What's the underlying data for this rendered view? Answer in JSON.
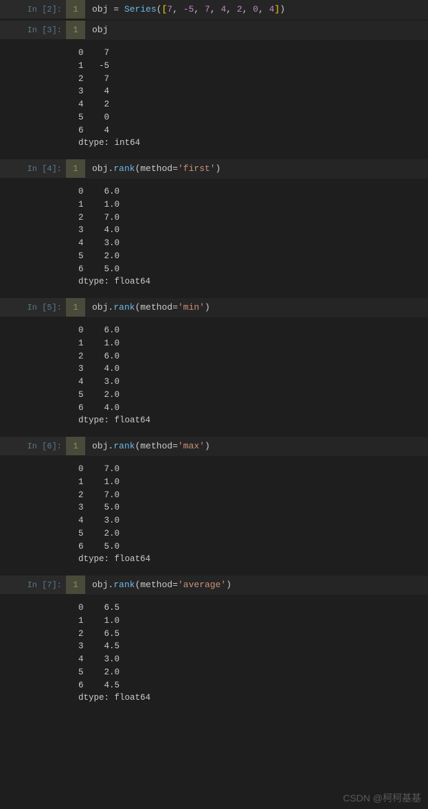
{
  "cells": [
    {
      "prompt": "In [2]:",
      "lineNo": "1",
      "code": [
        {
          "t": "obj ",
          "c": "tok-id"
        },
        {
          "t": "= ",
          "c": "tok-op"
        },
        {
          "t": "Series",
          "c": "tok-func"
        },
        {
          "t": "(",
          "c": "tok-punct"
        },
        {
          "t": "[",
          "c": "tok-bracket"
        },
        {
          "t": "7",
          "c": "tok-num"
        },
        {
          "t": ", ",
          "c": "tok-punct"
        },
        {
          "t": "-5",
          "c": "tok-num"
        },
        {
          "t": ", ",
          "c": "tok-punct"
        },
        {
          "t": "7",
          "c": "tok-num"
        },
        {
          "t": ", ",
          "c": "tok-punct"
        },
        {
          "t": "4",
          "c": "tok-num"
        },
        {
          "t": ", ",
          "c": "tok-punct"
        },
        {
          "t": "2",
          "c": "tok-num"
        },
        {
          "t": ", ",
          "c": "tok-punct"
        },
        {
          "t": "0",
          "c": "tok-num"
        },
        {
          "t": ", ",
          "c": "tok-punct"
        },
        {
          "t": "4",
          "c": "tok-num"
        },
        {
          "t": "]",
          "c": "tok-bracket"
        },
        {
          "t": ")",
          "c": "tok-punct"
        }
      ],
      "output": null
    },
    {
      "prompt": "In [3]:",
      "lineNo": "1",
      "code": [
        {
          "t": "obj",
          "c": "tok-id"
        }
      ],
      "output": "0    7\n1   -5\n2    7\n3    4\n4    2\n5    0\n6    4\ndtype: int64"
    },
    {
      "prompt": "In [4]:",
      "lineNo": "1",
      "code": [
        {
          "t": "obj",
          "c": "tok-id"
        },
        {
          "t": ".",
          "c": "tok-punct"
        },
        {
          "t": "rank",
          "c": "tok-func"
        },
        {
          "t": "(",
          "c": "tok-punct"
        },
        {
          "t": "method",
          "c": "tok-id"
        },
        {
          "t": "=",
          "c": "tok-op"
        },
        {
          "t": "'first'",
          "c": "tok-str"
        },
        {
          "t": ")",
          "c": "tok-punct"
        }
      ],
      "output": "0    6.0\n1    1.0\n2    7.0\n3    4.0\n4    3.0\n5    2.0\n6    5.0\ndtype: float64"
    },
    {
      "prompt": "In [5]:",
      "lineNo": "1",
      "code": [
        {
          "t": "obj",
          "c": "tok-id"
        },
        {
          "t": ".",
          "c": "tok-punct"
        },
        {
          "t": "rank",
          "c": "tok-func"
        },
        {
          "t": "(",
          "c": "tok-punct"
        },
        {
          "t": "method",
          "c": "tok-id"
        },
        {
          "t": "=",
          "c": "tok-op"
        },
        {
          "t": "'min'",
          "c": "tok-str"
        },
        {
          "t": ")",
          "c": "tok-punct"
        }
      ],
      "output": "0    6.0\n1    1.0\n2    6.0\n3    4.0\n4    3.0\n5    2.0\n6    4.0\ndtype: float64"
    },
    {
      "prompt": "In [6]:",
      "lineNo": "1",
      "code": [
        {
          "t": "obj",
          "c": "tok-id"
        },
        {
          "t": ".",
          "c": "tok-punct"
        },
        {
          "t": "rank",
          "c": "tok-func"
        },
        {
          "t": "(",
          "c": "tok-punct"
        },
        {
          "t": "method",
          "c": "tok-id"
        },
        {
          "t": "=",
          "c": "tok-op"
        },
        {
          "t": "'max'",
          "c": "tok-str"
        },
        {
          "t": ")",
          "c": "tok-punct"
        }
      ],
      "output": "0    7.0\n1    1.0\n2    7.0\n3    5.0\n4    3.0\n5    2.0\n6    5.0\ndtype: float64"
    },
    {
      "prompt": "In [7]:",
      "lineNo": "1",
      "code": [
        {
          "t": "obj",
          "c": "tok-id"
        },
        {
          "t": ".",
          "c": "tok-punct"
        },
        {
          "t": "rank",
          "c": "tok-func"
        },
        {
          "t": "(",
          "c": "tok-punct"
        },
        {
          "t": "method",
          "c": "tok-id"
        },
        {
          "t": "=",
          "c": "tok-op"
        },
        {
          "t": "'average'",
          "c": "tok-str"
        },
        {
          "t": ")",
          "c": "tok-punct"
        }
      ],
      "output": "0    6.5\n1    1.0\n2    6.5\n3    4.5\n4    3.0\n5    2.0\n6    4.5\ndtype: float64"
    }
  ],
  "watermark": "CSDN @柯柯基基"
}
